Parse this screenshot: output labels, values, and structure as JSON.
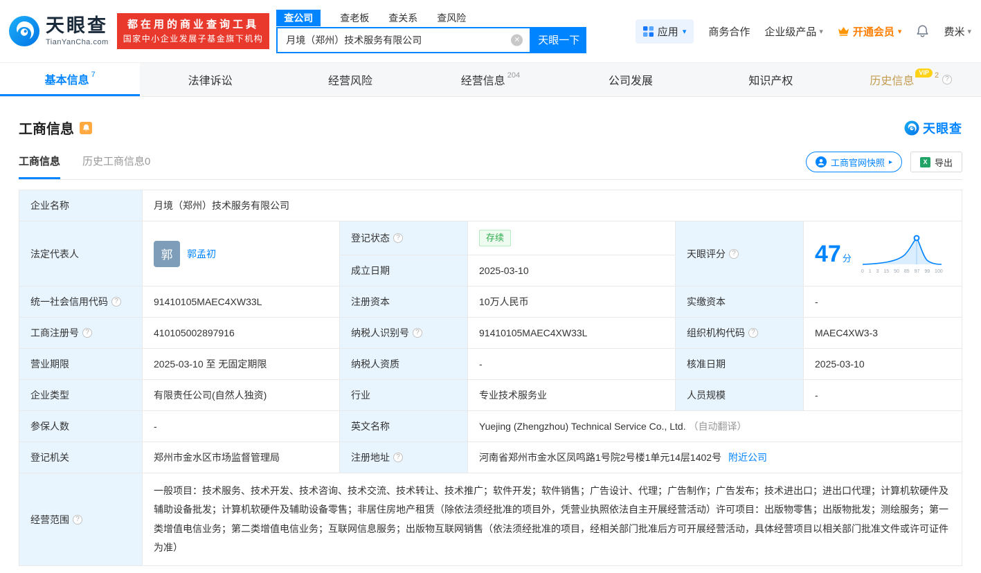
{
  "colors": {
    "accent": "#0084ff",
    "label_bg": "#e9f5fe",
    "status_green": "#2ead4b",
    "vip_orange": "#ff7e00",
    "promo_red": "#e8392c"
  },
  "icons": {
    "help": "?",
    "clear": "✕",
    "caret": "▾",
    "arrow_right": "▸",
    "excel": "X"
  },
  "header": {
    "logo": {
      "title": "天眼查",
      "subtitle": "TianYanCha.com"
    },
    "promo": {
      "line1": "都在用的商业查询工具",
      "line2": "国家中小企业发展子基金旗下机构"
    },
    "search": {
      "tabs": [
        {
          "label": "查公司"
        },
        {
          "label": "查老板"
        },
        {
          "label": "查关系"
        },
        {
          "label": "查风险"
        }
      ],
      "value": "月境（郑州）技术服务有限公司",
      "button": "天眼一下"
    },
    "menu": {
      "apps": "应用",
      "cooperation": "商务合作",
      "enterprise": "企业级产品",
      "vip": "开通会员",
      "user": "费米"
    }
  },
  "nav": {
    "vip_badge": "VIP",
    "tabs": [
      {
        "label": "基本信息",
        "count": "7"
      },
      {
        "label": "法律诉讼",
        "count": ""
      },
      {
        "label": "经营风险",
        "count": ""
      },
      {
        "label": "经营信息",
        "count": "204"
      },
      {
        "label": "公司发展",
        "count": ""
      },
      {
        "label": "知识产权",
        "count": ""
      },
      {
        "label": "历史信息",
        "count": "2"
      }
    ]
  },
  "section": {
    "title": "工商信息",
    "brand": "天眼查",
    "subtabs": [
      {
        "label": "工商信息"
      },
      {
        "label": "历史工商信息0"
      }
    ],
    "actions": {
      "snapshot": "工商官网快照",
      "export": "导出"
    }
  },
  "info": {
    "company_name": {
      "label": "企业名称",
      "value": "月境（郑州）技术服务有限公司"
    },
    "legal_rep": {
      "label": "法定代表人",
      "avatar": "郭",
      "name": "郭孟初"
    },
    "reg_status": {
      "label": "登记状态",
      "value": "存续"
    },
    "establish_date": {
      "label": "成立日期",
      "value": "2025-03-10"
    },
    "score": {
      "label": "天眼评分",
      "value": "47",
      "unit": "分",
      "ticks": [
        "0",
        "1",
        "3",
        "15",
        "50",
        "85",
        "97",
        "99",
        "100"
      ]
    },
    "credit_code": {
      "label": "统一社会信用代码",
      "value": "91410105MAEC4XW33L"
    },
    "reg_capital": {
      "label": "注册资本",
      "value": "10万人民币"
    },
    "paid_capital": {
      "label": "实缴资本",
      "value": "-"
    },
    "reg_number": {
      "label": "工商注册号",
      "value": "410105002897916"
    },
    "taxpayer_id": {
      "label": "纳税人识别号",
      "value": "91410105MAEC4XW33L"
    },
    "org_code": {
      "label": "组织机构代码",
      "value": "MAEC4XW3-3"
    },
    "business_term": {
      "label": "营业期限",
      "value": "2025-03-10 至 无固定期限"
    },
    "taxpayer_quality": {
      "label": "纳税人资质",
      "value": "-"
    },
    "approval_date": {
      "label": "核准日期",
      "value": "2025-03-10"
    },
    "company_type": {
      "label": "企业类型",
      "value": "有限责任公司(自然人独资)"
    },
    "industry": {
      "label": "行业",
      "value": "专业技术服务业"
    },
    "staff_size": {
      "label": "人员规模",
      "value": "-"
    },
    "insured_count": {
      "label": "参保人数",
      "value": "-"
    },
    "english_name": {
      "label": "英文名称",
      "value": "Yuejing (Zhengzhou) Technical Service Co., Ltd.",
      "note": "（自动翻译）"
    },
    "reg_authority": {
      "label": "登记机关",
      "value": "郑州市金水区市场监督管理局"
    },
    "reg_address": {
      "label": "注册地址",
      "value": "河南省郑州市金水区凤鸣路1号院2号楼1单元14层1402号",
      "link": "附近公司"
    },
    "business_scope": {
      "label": "经营范围",
      "value": "一般项目：技术服务、技术开发、技术咨询、技术交流、技术转让、技术推广；软件开发；软件销售；广告设计、代理；广告制作；广告发布；技术进出口；进出口代理；计算机软硬件及辅助设备批发；计算机软硬件及辅助设备零售；非居住房地产租赁（除依法须经批准的项目外，凭营业执照依法自主开展经营活动）许可项目：出版物零售；出版物批发；测绘服务；第一类增值电信业务；第二类增值电信业务；互联网信息服务；出版物互联网销售（依法须经批准的项目，经相关部门批准后方可开展经营活动，具体经营项目以相关部门批准文件或许可证件为准）"
    }
  }
}
